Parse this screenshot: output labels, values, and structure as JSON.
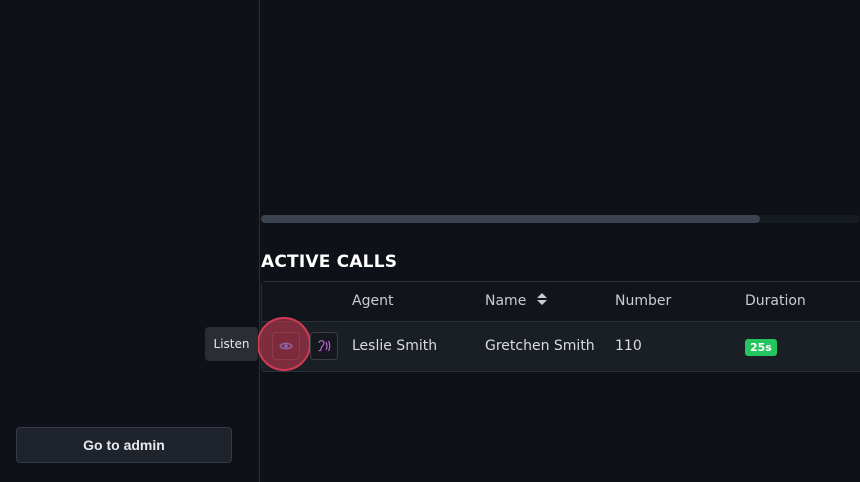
{
  "sidebar": {
    "admin_button_label": "Go to admin"
  },
  "active_calls": {
    "title": "ACTIVE CALLS",
    "columns": [
      "Agent",
      "Name",
      "Number",
      "Duration"
    ],
    "rows": [
      {
        "agent": "Leslie Smith",
        "name": "Gretchen Smith",
        "number": "110",
        "duration": "25s"
      }
    ]
  },
  "tooltip": {
    "text": "Listen"
  },
  "icons": {
    "listen": "eye-icon",
    "whisper": "sound-waves-icon",
    "sort": "sort-icon"
  },
  "colors": {
    "background": "#0e1117",
    "highlight": "#d13a55",
    "duration_badge": "#22c55e"
  }
}
